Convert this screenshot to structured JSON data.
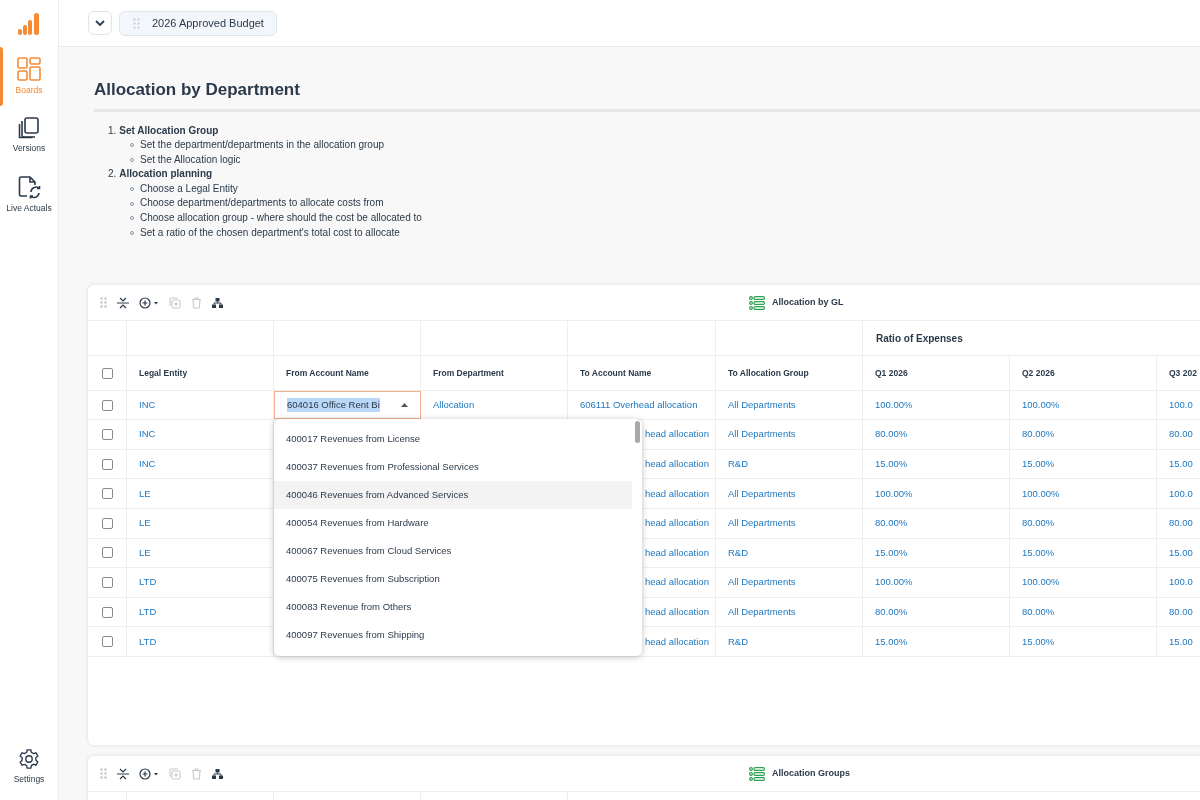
{
  "sidebar": {
    "items": [
      {
        "label": "Boards",
        "selected": true
      },
      {
        "label": "Versions",
        "selected": false
      },
      {
        "label": "Live Actuals",
        "selected": false
      }
    ],
    "bottom_item": {
      "label": "Settings"
    }
  },
  "top_bar": {
    "board_tab": "2026 Approved Budget"
  },
  "content": {
    "title": "Allocation by Department",
    "steps": [
      {
        "number": "1.",
        "title": "Set Allocation Group",
        "bullets": [
          "Set the department/departments in the allocation group",
          "Set the Allocation logic"
        ]
      },
      {
        "number": "2.",
        "title": "Allocation planning",
        "bullets": [
          "Choose a Legal Entity",
          "Choose department/departments to allocate costs from",
          "Choose allocation group - where should the cost be allocated to",
          "Set a ratio of the chosen department's total cost to allocate"
        ]
      }
    ]
  },
  "table": {
    "title": "Allocation by GL",
    "group_header": "Ratio of Expenses",
    "select_all_checked": false,
    "columns": [
      "Legal Entity",
      "From Account Name",
      "From Department",
      "To Account Name",
      "To Allocation Group",
      "Q1 2026",
      "Q2 2026",
      "Q3 202"
    ],
    "rows": [
      {
        "checked": false,
        "cells": [
          "INC",
          "604016 Office Rent Bi",
          "Allocation",
          "606111 Overhead allocation",
          "All Departments",
          "100.00%",
          "100.00%",
          "100.0"
        ]
      },
      {
        "checked": false,
        "cells": [
          "INC",
          "",
          "",
          "head allocation",
          "All Departments",
          "80.00%",
          "80.00%",
          "80.00"
        ]
      },
      {
        "checked": false,
        "cells": [
          "INC",
          "",
          "",
          "head allocation",
          "R&D",
          "15.00%",
          "15.00%",
          "15.00"
        ]
      },
      {
        "checked": false,
        "cells": [
          "LE",
          "",
          "",
          "head allocation",
          "All Departments",
          "100.00%",
          "100.00%",
          "100.0"
        ]
      },
      {
        "checked": false,
        "cells": [
          "LE",
          "",
          "",
          "head allocation",
          "All Departments",
          "80.00%",
          "80.00%",
          "80.00"
        ]
      },
      {
        "checked": false,
        "cells": [
          "LE",
          "",
          "",
          "head allocation",
          "R&D",
          "15.00%",
          "15.00%",
          "15.00"
        ]
      },
      {
        "checked": false,
        "cells": [
          "LTD",
          "",
          "",
          "head allocation",
          "All Departments",
          "100.00%",
          "100.00%",
          "100.0"
        ]
      },
      {
        "checked": false,
        "cells": [
          "LTD",
          "",
          "",
          "head allocation",
          "All Departments",
          "80.00%",
          "80.00%",
          "80.00"
        ]
      },
      {
        "checked": false,
        "cells": [
          "LTD",
          "",
          "",
          "head allocation",
          "R&D",
          "15.00%",
          "15.00%",
          "15.00"
        ]
      }
    ],
    "dropdown": {
      "options": [
        {
          "label": "400017 Revenues from License",
          "selected": false
        },
        {
          "label": "400037 Revenues from Professional Services",
          "selected": false
        },
        {
          "label": "400046 Revenues from Advanced Services",
          "selected": true
        },
        {
          "label": "400054 Revenues from Hardware",
          "selected": false
        },
        {
          "label": "400067 Revenues from Cloud Services",
          "selected": false
        },
        {
          "label": "400075 Revenues from Subscription",
          "selected": false
        },
        {
          "label": "400083 Revenue from Others",
          "selected": false
        },
        {
          "label": "400097 Revenues from Shipping",
          "selected": false
        }
      ]
    }
  },
  "table_2": {
    "title": "Allocation Groups"
  }
}
